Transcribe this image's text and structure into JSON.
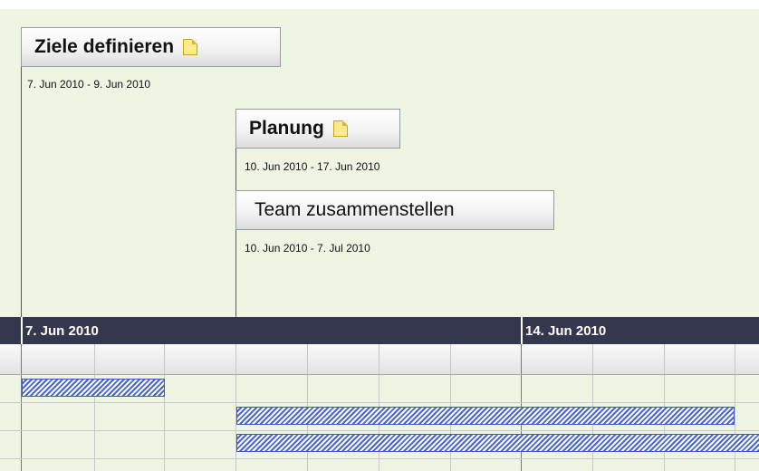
{
  "tasks": [
    {
      "title": "Ziele definieren",
      "dates": "7. Jun 2010 - 9. Jun 2010",
      "has_note": true
    },
    {
      "title": "Planung",
      "dates": "10. Jun 2010 - 17. Jun 2010",
      "has_note": true
    },
    {
      "title": "Team zusammenstellen",
      "dates": "10. Jun 2010 - 7. Jul 2010",
      "has_note": false
    }
  ],
  "timeline": {
    "weeks": [
      "7. Jun 2010",
      "14. Jun 2010"
    ]
  },
  "colors": {
    "background": "#eef6e3",
    "header": "#34374d",
    "bar_stripe": "#4a66d4",
    "bar_border": "#3e59c4"
  }
}
